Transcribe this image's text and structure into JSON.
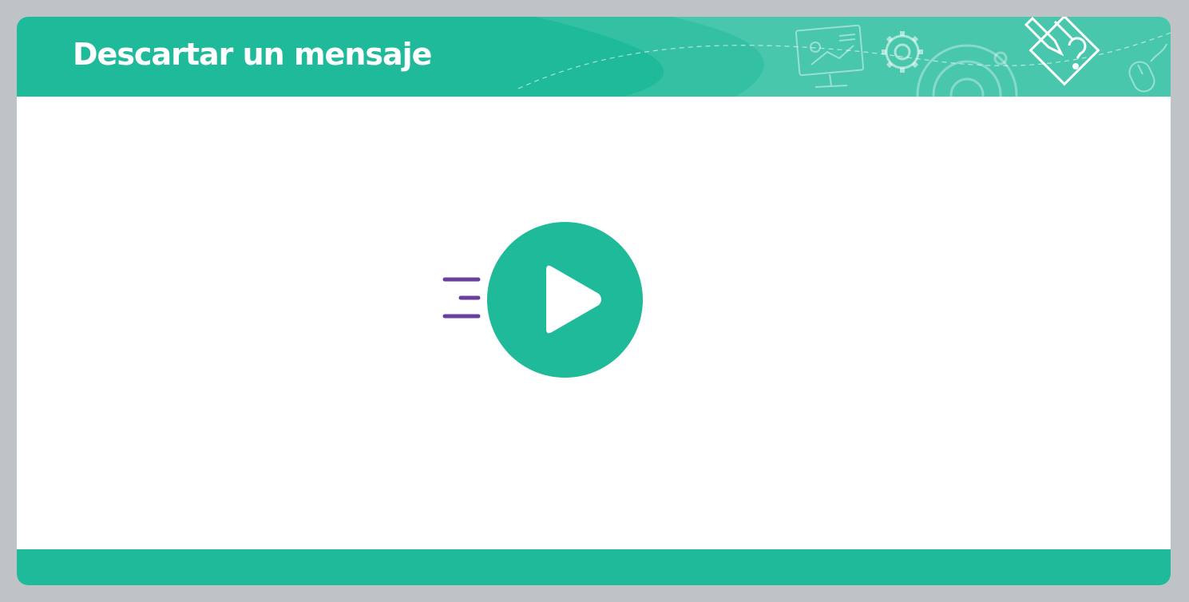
{
  "header": {
    "title": "Descartar un mensaje"
  },
  "player": {
    "play_icon": "play-icon",
    "speed_icon": "speed-lines-icon"
  },
  "decor_icons": [
    "presentation-board-icon",
    "gear-icon",
    "large-gear-icon",
    "pencil-question-icon",
    "mouse-icon"
  ],
  "colors": {
    "brand_green": "#1eba99",
    "accent_purple": "#6b3fa0",
    "background_gray": "#bfc3c6",
    "content_white": "#ffffff"
  }
}
